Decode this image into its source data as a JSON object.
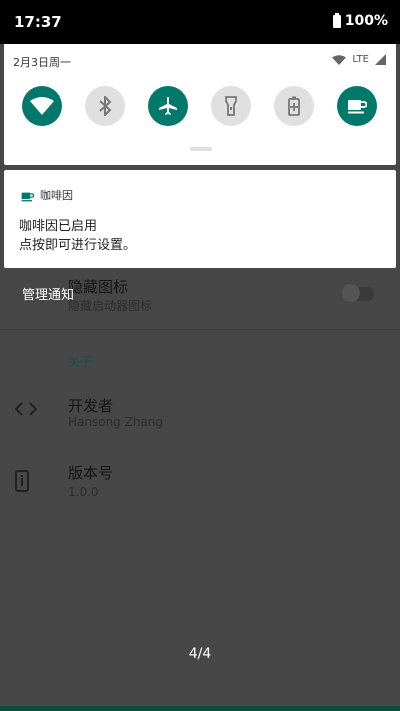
{
  "status_bar": {
    "time": "17:37",
    "battery": "100%"
  },
  "quick_settings": {
    "date": "2月3日周一",
    "network": "LTE",
    "tiles": [
      {
        "icon": "wifi-icon",
        "state": "on"
      },
      {
        "icon": "bluetooth-icon",
        "state": "off"
      },
      {
        "icon": "airplane-icon",
        "state": "on"
      },
      {
        "icon": "flashlight-icon",
        "state": "off"
      },
      {
        "icon": "battery-saver-icon",
        "state": "off"
      },
      {
        "icon": "coffee-icon",
        "state": "on"
      }
    ]
  },
  "notification": {
    "app_name": "咖啡因",
    "title": "咖啡因已启用",
    "text": "点按即可进行设置。"
  },
  "background_app": {
    "hide_icon_title": "隐藏图标",
    "hide_icon_sub": "隐藏启动器图标",
    "manage_notifications": "管理通知",
    "section_about": "关于",
    "developer_title": "开发者",
    "developer_name": "Hansong Zhang",
    "version_title": "版本号",
    "version_value": "1.0.0",
    "page_indicator": "4/4"
  },
  "colors": {
    "accent": "#00796b",
    "panel": "#ffffff",
    "scrim": "#474747"
  }
}
